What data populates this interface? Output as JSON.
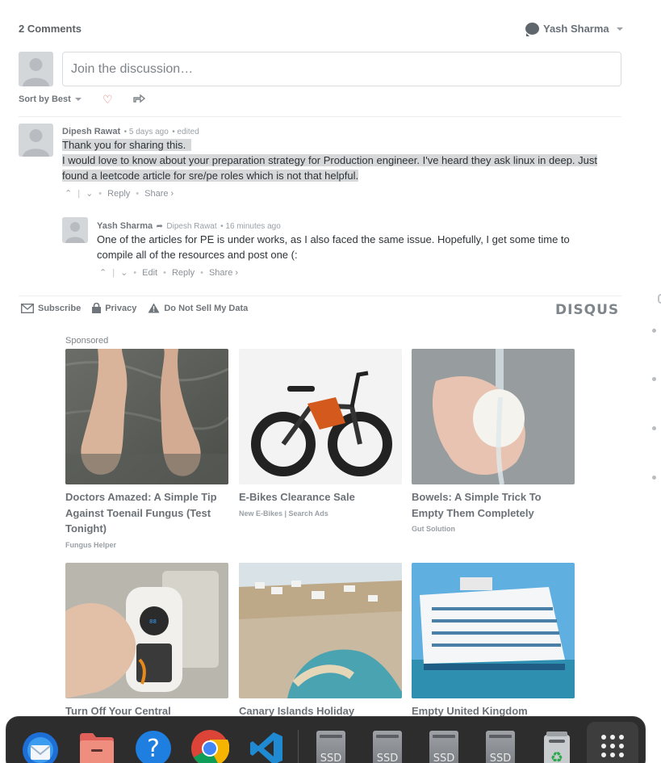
{
  "header": {
    "comments_count": "2 Comments",
    "user_name": "Yash Sharma"
  },
  "composer": {
    "placeholder": "Join the discussion…"
  },
  "sort": {
    "label": "Sort by Best"
  },
  "comments": [
    {
      "author": "Dipesh Rawat",
      "time": "5 days ago",
      "edited": "edited",
      "line1": "Thank you for sharing this.",
      "line2": "I would love to know about your preparation strategy for Production engineer. I've heard they ask linux in deep. Just",
      "line3": "found a leetcode article for sre/pe roles which is not that helpful.",
      "reply_label": "Reply",
      "share_label": "Share ›"
    },
    {
      "author": "Yash Sharma",
      "reply_to": "Dipesh Rawat",
      "time": "16 minutes ago",
      "line1": "One of the articles for PE is under works, as I also faced the same issue. Hopefully, I get some time to",
      "line2": "compile all of the resources and post one (:",
      "edit_label": "Edit",
      "reply_label": "Reply",
      "share_label": "Share ›"
    }
  ],
  "footer": {
    "subscribe": "Subscribe",
    "privacy": "Privacy",
    "do_not_sell": "Do Not Sell My Data",
    "brand": "DISQUS"
  },
  "sponsored": {
    "label": "Sponsored",
    "ads": [
      {
        "title": "Doctors Amazed: A Simple Tip Against Toenail Fungus (Test Tonight)",
        "source": "Fungus Helper"
      },
      {
        "title": "E-Bikes Clearance Sale",
        "source": "New E-Bikes | Search Ads"
      },
      {
        "title": "Bowels: A Simple Trick To Empty Them Completely",
        "source": "Gut Solution"
      },
      {
        "title": "Turn Off Your Central",
        "source": ""
      },
      {
        "title": "Canary Islands Holiday",
        "source": ""
      },
      {
        "title": "Empty United Kingdom",
        "source": ""
      }
    ]
  },
  "dock": {
    "ssd_label": "SSD"
  }
}
